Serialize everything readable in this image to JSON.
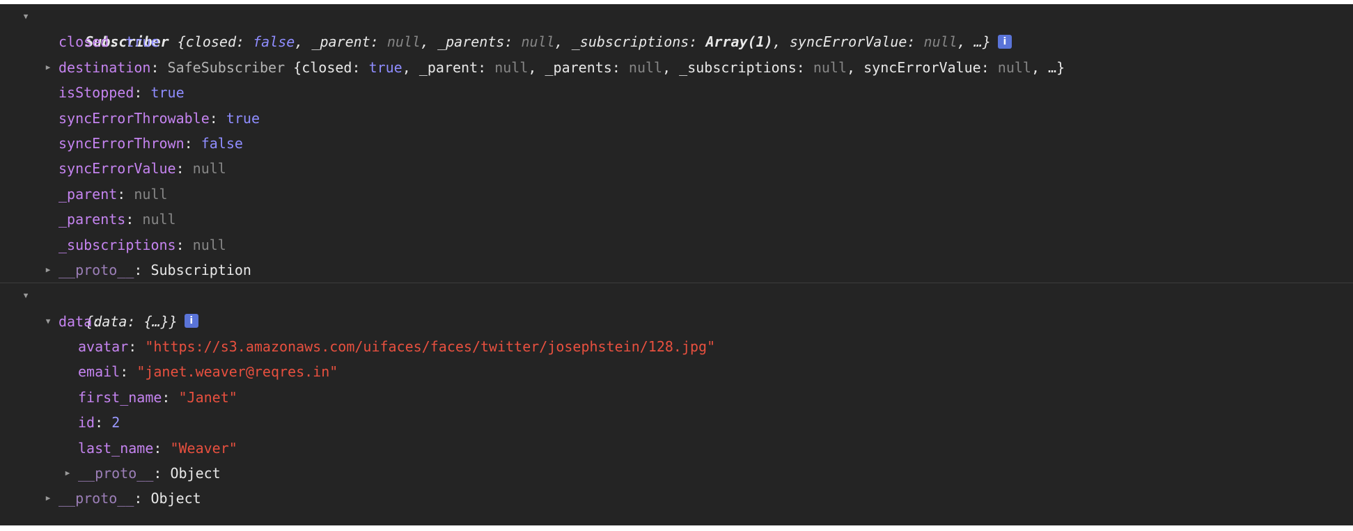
{
  "glyphs": {
    "expanded": "▼",
    "collapsed": "▶",
    "info": "i",
    "ellipsis": "…"
  },
  "subscriber": {
    "summary": {
      "class_name": "Subscriber",
      "preview_closed_key": "closed",
      "preview_closed_val": "false",
      "preview_parent_key": "_parent",
      "preview_parent_val": "null",
      "preview_parents_key": "_parents",
      "preview_parents_val": "null",
      "preview_subs_key": "_subscriptions",
      "preview_subs_val": "Array(1)",
      "preview_syncval_key": "syncErrorValue",
      "preview_syncval_val": "null"
    },
    "closed": {
      "key": "closed",
      "value": "true"
    },
    "destination": {
      "key": "destination",
      "class_name": "SafeSubscriber",
      "closed_key": "closed",
      "closed_val": "true",
      "parent_key": "_parent",
      "parent_val": "null",
      "parents_key": "_parents",
      "parents_val": "null",
      "subs_key": "_subscriptions",
      "subs_val": "null",
      "syncval_key": "syncErrorValue",
      "syncval_val": "null"
    },
    "isStopped": {
      "key": "isStopped",
      "value": "true"
    },
    "syncErrorThrowable": {
      "key": "syncErrorThrowable",
      "value": "true"
    },
    "syncErrorThrown": {
      "key": "syncErrorThrown",
      "value": "false"
    },
    "syncErrorValue": {
      "key": "syncErrorValue",
      "value": "null"
    },
    "parent": {
      "key": "_parent",
      "value": "null"
    },
    "parents": {
      "key": "_parents",
      "value": "null"
    },
    "subscriptions": {
      "key": "_subscriptions",
      "value": "null"
    },
    "proto": {
      "key": "__proto__",
      "value": "Subscription"
    }
  },
  "response": {
    "summary": {
      "key": "data",
      "value": "{…}"
    },
    "data": {
      "key": "data",
      "avatar": {
        "key": "avatar",
        "value": "\"https://s3.amazonaws.com/uifaces/faces/twitter/josephstein/128.jpg\""
      },
      "email": {
        "key": "email",
        "value": "\"janet.weaver@reqres.in\""
      },
      "first_name": {
        "key": "first_name",
        "value": "\"Janet\""
      },
      "id": {
        "key": "id",
        "value": "2"
      },
      "last_name": {
        "key": "last_name",
        "value": "\"Weaver\""
      },
      "proto": {
        "key": "__proto__",
        "value": "Object"
      }
    },
    "proto": {
      "key": "__proto__",
      "value": "Object"
    }
  }
}
